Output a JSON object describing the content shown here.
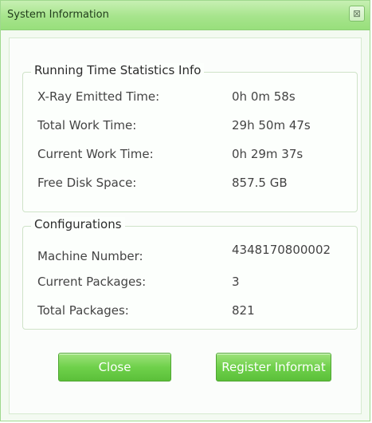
{
  "window": {
    "title": "System Information",
    "close_glyph": "⊠"
  },
  "running": {
    "title": "Running Time Statistics Info",
    "rows": [
      {
        "label": "X-Ray Emitted Time:",
        "value": "0h 0m 58s"
      },
      {
        "label": "Total Work Time:",
        "value": "29h 50m 47s"
      },
      {
        "label": "Current Work Time:",
        "value": "0h 29m 37s"
      },
      {
        "label": "Free Disk Space:",
        "value": "857.5 GB"
      }
    ]
  },
  "config": {
    "title": "Configurations",
    "rows": [
      {
        "label": "Machine Number:",
        "value": "4348170800002"
      },
      {
        "label": "Current Packages:",
        "value": "3"
      },
      {
        "label": "Total Packages:",
        "value": "821"
      }
    ]
  },
  "buttons": {
    "close": "Close",
    "register": "Register Informat"
  },
  "colors": {
    "accent": "#6fd14b",
    "title_bar": "#a6e48c"
  }
}
